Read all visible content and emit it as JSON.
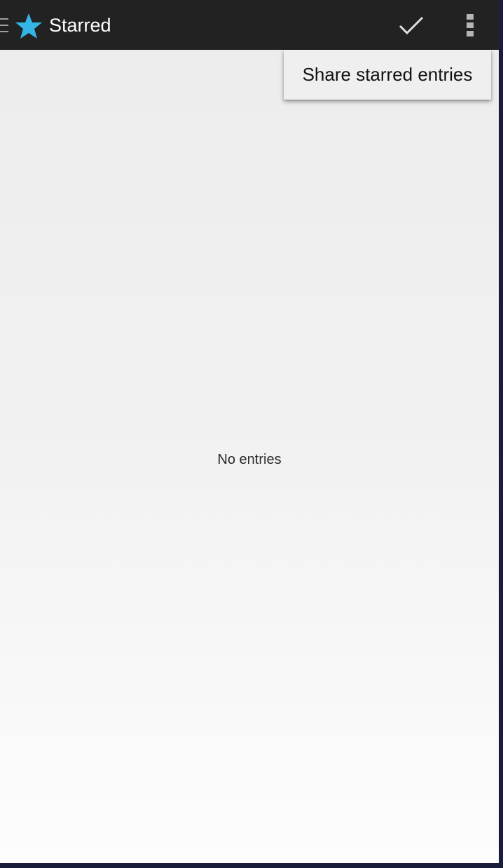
{
  "action_bar": {
    "title": "Starred",
    "icons": {
      "drawer": "drawer-menu-icon",
      "app": "star-icon",
      "confirm": "checkmark-icon",
      "overflow": "overflow-menu-icon"
    },
    "colors": {
      "background": "#222222",
      "star": "#33b5e5",
      "title": "#ffffff"
    }
  },
  "overflow_menu": {
    "items": [
      {
        "label": "Share starred entries"
      }
    ]
  },
  "main": {
    "empty_message": "No entries"
  }
}
